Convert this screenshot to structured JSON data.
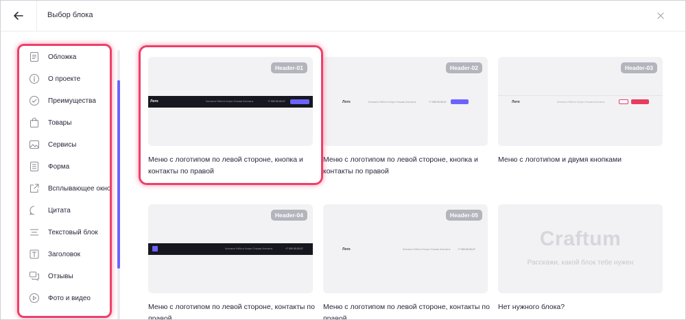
{
  "header": {
    "title": "Выбор блока"
  },
  "sidebar": {
    "items": [
      {
        "label": "Обложка",
        "icon": "cover-icon"
      },
      {
        "label": "О проекте",
        "icon": "info-icon"
      },
      {
        "label": "Преимущества",
        "icon": "check-circle-icon"
      },
      {
        "label": "Товары",
        "icon": "shopping-bag-icon"
      },
      {
        "label": "Сервисы",
        "icon": "image-icon"
      },
      {
        "label": "Форма",
        "icon": "form-icon"
      },
      {
        "label": "Всплывающее окно",
        "icon": "popup-icon"
      },
      {
        "label": "Цитата",
        "icon": "quote-bubble-icon"
      },
      {
        "label": "Текстовый блок",
        "icon": "text-lines-icon"
      },
      {
        "label": "Заголовок",
        "icon": "heading-icon"
      },
      {
        "label": "Отзывы",
        "icon": "reviews-icon"
      },
      {
        "label": "Фото и видео",
        "icon": "play-icon"
      }
    ]
  },
  "cards": [
    {
      "badge": "Header-01",
      "desc": "Меню с логотипом по левой стороне, кнопка и контакты по правой"
    },
    {
      "badge": "Header-02",
      "desc": "Меню с логотипом по левой стороне, кнопка и контакты по правой"
    },
    {
      "badge": "Header-03",
      "desc": "Меню с логотипом и двумя кнопками"
    },
    {
      "badge": "Header-04",
      "desc": "Меню с логотипом по левой стороне, контакты по правой"
    },
    {
      "badge": "Header-05",
      "desc": "Меню с логотипом по левой стороне, контакты по правой"
    },
    {
      "desc": "Нет нужного блока?"
    }
  ],
  "preview": {
    "logo": "Лого",
    "nav": "Контакты   Работа   Услуги   Отзывы   Контакты",
    "phone": "+7 000 00-00-07",
    "cta": "Оставить заявку"
  },
  "craftum": {
    "logo": "Craftum",
    "subtitle": "Расскажи, какой блок тебе нужен"
  },
  "colors": {
    "highlight": "#ef3f68",
    "accent": "#6c63ff",
    "cta_red": "#e83b5e"
  }
}
